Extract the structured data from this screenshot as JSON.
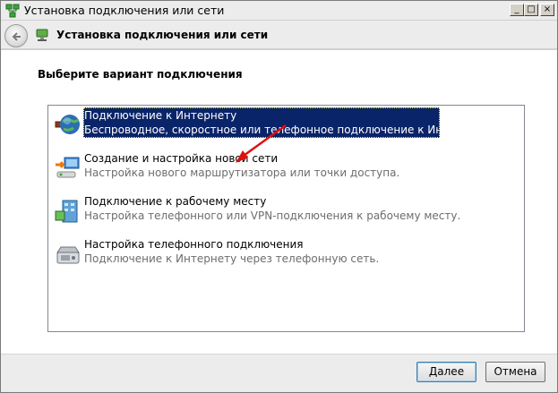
{
  "window": {
    "title": "Установка подключения или сети",
    "controls": [
      "_",
      "□",
      "×"
    ]
  },
  "nav": {
    "title": "Установка подключения или сети"
  },
  "content": {
    "prompt": "Выберите вариант подключения",
    "options": [
      {
        "icon": "globe-icon",
        "title": "Подключение к Интернету",
        "description": "Беспроводное, скоростное или телефонное подключение к Интернету.",
        "selected": true
      },
      {
        "icon": "new-network-icon",
        "title": "Создание и настройка новой сети",
        "description": "Настройка нового маршрутизатора или точки доступа.",
        "selected": false
      },
      {
        "icon": "workplace-icon",
        "title": "Подключение к рабочему месту",
        "description": "Настройка телефонного или VPN-подключения к рабочему месту.",
        "selected": false
      },
      {
        "icon": "phone-modem-icon",
        "title": "Настройка телефонного подключения",
        "description": "Подключение к Интернету через телефонную сеть.",
        "selected": false
      }
    ]
  },
  "footer": {
    "next_label": "Далее",
    "cancel_label": "Отмена"
  },
  "colors": {
    "selection": "#0a246a",
    "annotation_arrow": "#e01010",
    "description_text": "#6d6d6d"
  }
}
